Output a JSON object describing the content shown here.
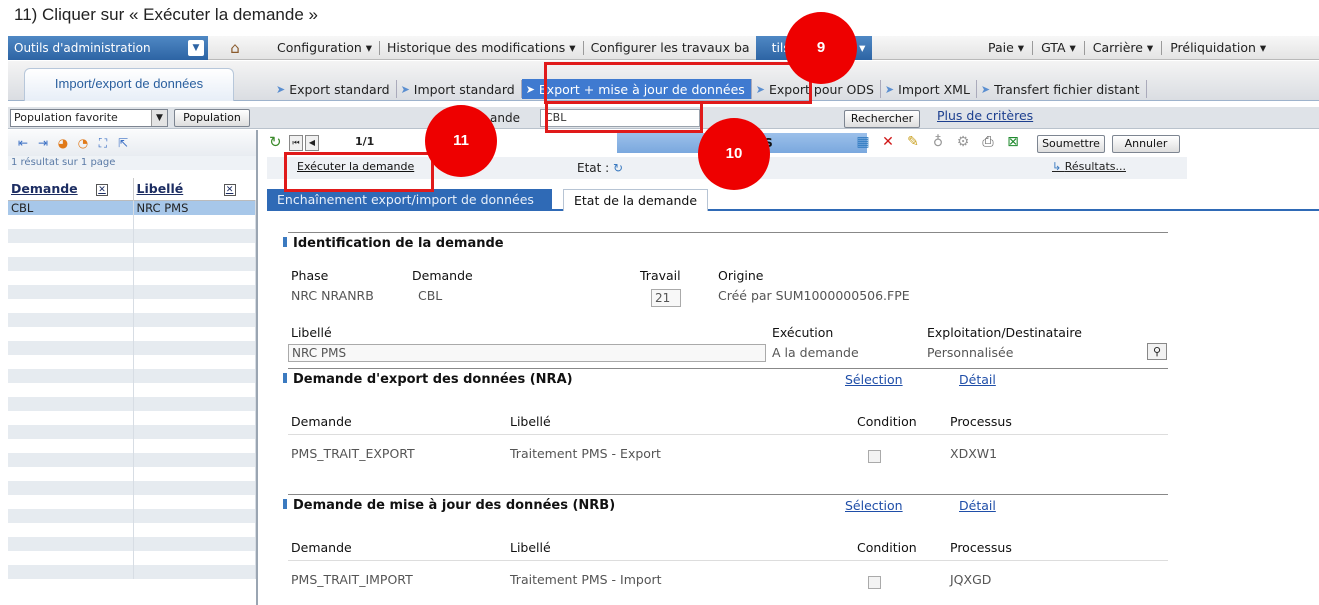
{
  "caption": "11) Cliquer sur « Exécuter la demande »",
  "topbar": {
    "admin_label": "Outils d'administration",
    "menu": [
      {
        "label": "Configuration ▾"
      },
      {
        "label": "Historique des modifications ▾"
      },
      {
        "label": "Configurer les travaux ba"
      },
      {
        "label": "tils communs ▾",
        "active": true
      }
    ],
    "menu_right": [
      {
        "label": "Paie ▾"
      },
      {
        "label": "GTA ▾"
      },
      {
        "label": "Carrière ▾"
      },
      {
        "label": "Préliquidation ▾"
      }
    ]
  },
  "module_tab": "Import/export de données",
  "subtabs": [
    {
      "label": "Export standard"
    },
    {
      "label": "Import standard"
    },
    {
      "label": "Export + mise à jour de données",
      "active": true
    },
    {
      "label": "Export pour ODS"
    },
    {
      "label": "Import XML"
    },
    {
      "label": "Transfert fichier distant"
    }
  ],
  "search": {
    "population_select": "Population favorite",
    "population_button": "Population",
    "demande_label": "ande",
    "demande_value": "CBL",
    "search_button": "Rechercher",
    "more_criteria": "Plus de critères"
  },
  "left": {
    "count": "1 résultat sur 1 page",
    "col_demande": "Demande",
    "col_libelle": "Libellé",
    "rows": [
      {
        "demande": "CBL",
        "libelle": "NRC PMS"
      }
    ]
  },
  "record": {
    "page": "1/1",
    "title": "NRC PMS",
    "submit_button": "Soumettre",
    "cancel_button": "Annuler",
    "exec_link": "Exécuter la demande",
    "etat_label": "Etat :",
    "results_link": "Résultats..."
  },
  "tabs": [
    "Enchaînement export/import de données",
    "Etat de la demande"
  ],
  "identification": {
    "title": "Identification de la demande",
    "phase_label": "Phase",
    "phase_value": "NRC  NRANRB",
    "demande_label": "Demande",
    "demande_value": "CBL",
    "travail_label": "Travail",
    "travail_value": "21",
    "origine_label": "Origine",
    "origine_value": "Créé par SUM1000000506.FPE",
    "libelle_label": "Libellé",
    "libelle_value": "NRC PMS",
    "execution_label": "Exécution",
    "execution_value": "A la demande",
    "exploitation_label": "Exploitation/Destinataire",
    "exploitation_value": "Personnalisée"
  },
  "export_section": {
    "title": "Demande d'export des données (NRA)",
    "selection": "Sélection",
    "detail": "Détail",
    "col_demande": "Demande",
    "col_libelle": "Libellé",
    "col_condition": "Condition",
    "col_processus": "Processus",
    "row": {
      "demande": "PMS_TRAIT_EXPORT",
      "libelle": "Traitement PMS - Export",
      "processus": "XDXW1"
    }
  },
  "update_section": {
    "title": "Demande de mise à jour des données (NRB)",
    "selection": "Sélection",
    "detail": "Détail",
    "col_demande": "Demande",
    "col_libelle": "Libellé",
    "col_condition": "Condition",
    "col_processus": "Processus",
    "row": {
      "demande": "PMS_TRAIT_IMPORT",
      "libelle": "Traitement PMS - Import",
      "processus": "JQXGD"
    }
  },
  "annotations": [
    "9",
    "10",
    "11"
  ],
  "colors": {
    "annotation_red": "#ee0000",
    "accent_blue": "#2f6ab6",
    "selected_row": "#a7c7e9"
  }
}
